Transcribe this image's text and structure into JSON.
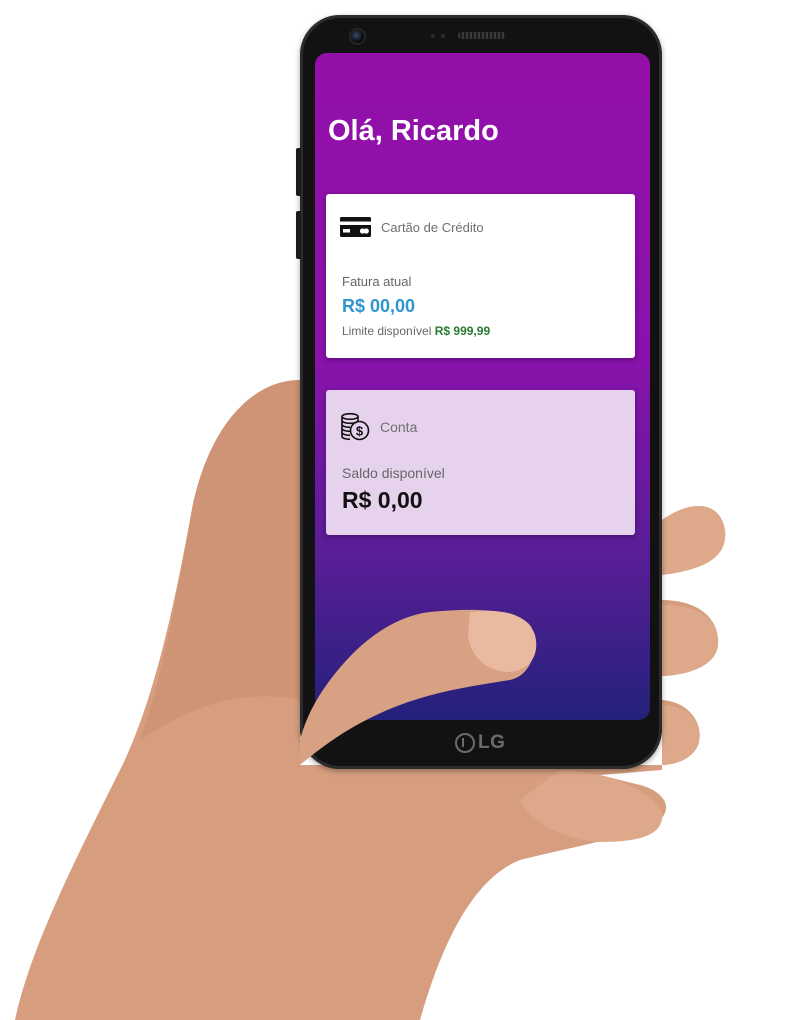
{
  "device": {
    "brand": "LG"
  },
  "greeting": "Olá, Ricardo",
  "credit_card": {
    "title": "Cartão de Crédito",
    "icon": "credit-card-icon",
    "invoice_label": "Fatura atual",
    "invoice_amount": "R$ 00,00",
    "limit_label": "Limite disponível",
    "limit_value": "R$ 999,99",
    "colors": {
      "amount": "#2f96d0",
      "limit_value": "#2a7a31"
    }
  },
  "account": {
    "title": "Conta",
    "icon": "coins-dollar-icon",
    "balance_label": "Saldo disponível",
    "balance_amount": "R$ 0,00"
  },
  "colors": {
    "screen_gradient_top": "#9410a9",
    "screen_gradient_bottom": "#23217a",
    "account_card_bg": "#e7d2ee"
  }
}
